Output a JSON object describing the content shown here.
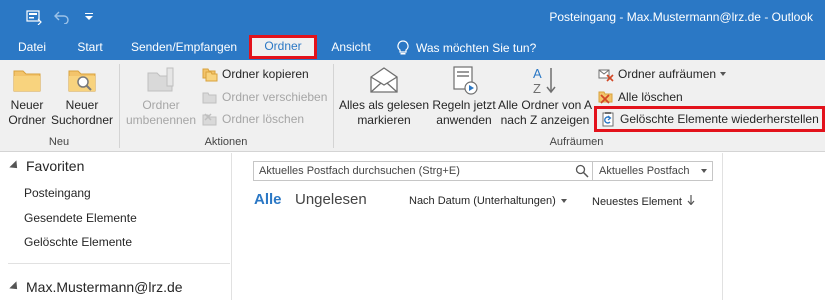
{
  "window": {
    "title": "Posteingang - Max.Mustermann@lrz.de - Outlook",
    "colors": {
      "accent": "#2b78c5",
      "ribbon_bg": "#f0f0f0",
      "highlight": "#e3121b",
      "link_blue": "#2b78c5"
    }
  },
  "qat": {
    "icons": [
      "send-receive-icon",
      "undo-icon",
      "customize-qat-icon"
    ]
  },
  "tabs": [
    {
      "label": "Datei"
    },
    {
      "label": "Start"
    },
    {
      "label": "Senden/Empfangen"
    },
    {
      "label": "Ordner",
      "active": true
    },
    {
      "label": "Ansicht"
    }
  ],
  "tell_me": {
    "label": "Was möchten Sie tun?",
    "icon": "lightbulb-icon"
  },
  "ribbon": {
    "neu": {
      "label": "Neu",
      "new_folder": {
        "line1": "Neuer",
        "line2": "Ordner"
      },
      "new_search_folder": {
        "line1": "Neuer",
        "line2": "Suchordner"
      }
    },
    "aktionen": {
      "label": "Aktionen",
      "rename_folder": {
        "line1": "Ordner",
        "line2": "umbenennen"
      },
      "copy_folder": "Ordner kopieren",
      "move_folder": "Ordner verschieben",
      "delete_folder": "Ordner löschen"
    },
    "aufraeumen": {
      "label": "Aufräumen",
      "mark_all_read": {
        "line1": "Alles als gelesen",
        "line2": "markieren"
      },
      "run_rules": {
        "line1": "Regeln jetzt",
        "line2": "anwenden"
      },
      "sort_az": {
        "line1": "Alle Ordner von A",
        "line2": "nach Z anzeigen"
      },
      "clean_up": "Ordner aufräumen",
      "delete_all": "Alle löschen",
      "recover_deleted": "Gelöschte Elemente wiederherstellen"
    }
  },
  "folder_pane": {
    "favorites_header": "Favoriten",
    "favorites": [
      "Posteingang",
      "Gesendete Elemente",
      "Gelöschte Elemente"
    ],
    "account_header": "Max.Mustermann@lrz.de"
  },
  "message_list": {
    "search_placeholder": "Aktuelles Postfach durchsuchen (Strg+E)",
    "search_scope": "Aktuelles Postfach",
    "filter_all": "Alle",
    "filter_unread": "Ungelesen",
    "sort_by": "Nach Datum (Unterhaltungen)",
    "sort_order": "Neuestes Element"
  }
}
